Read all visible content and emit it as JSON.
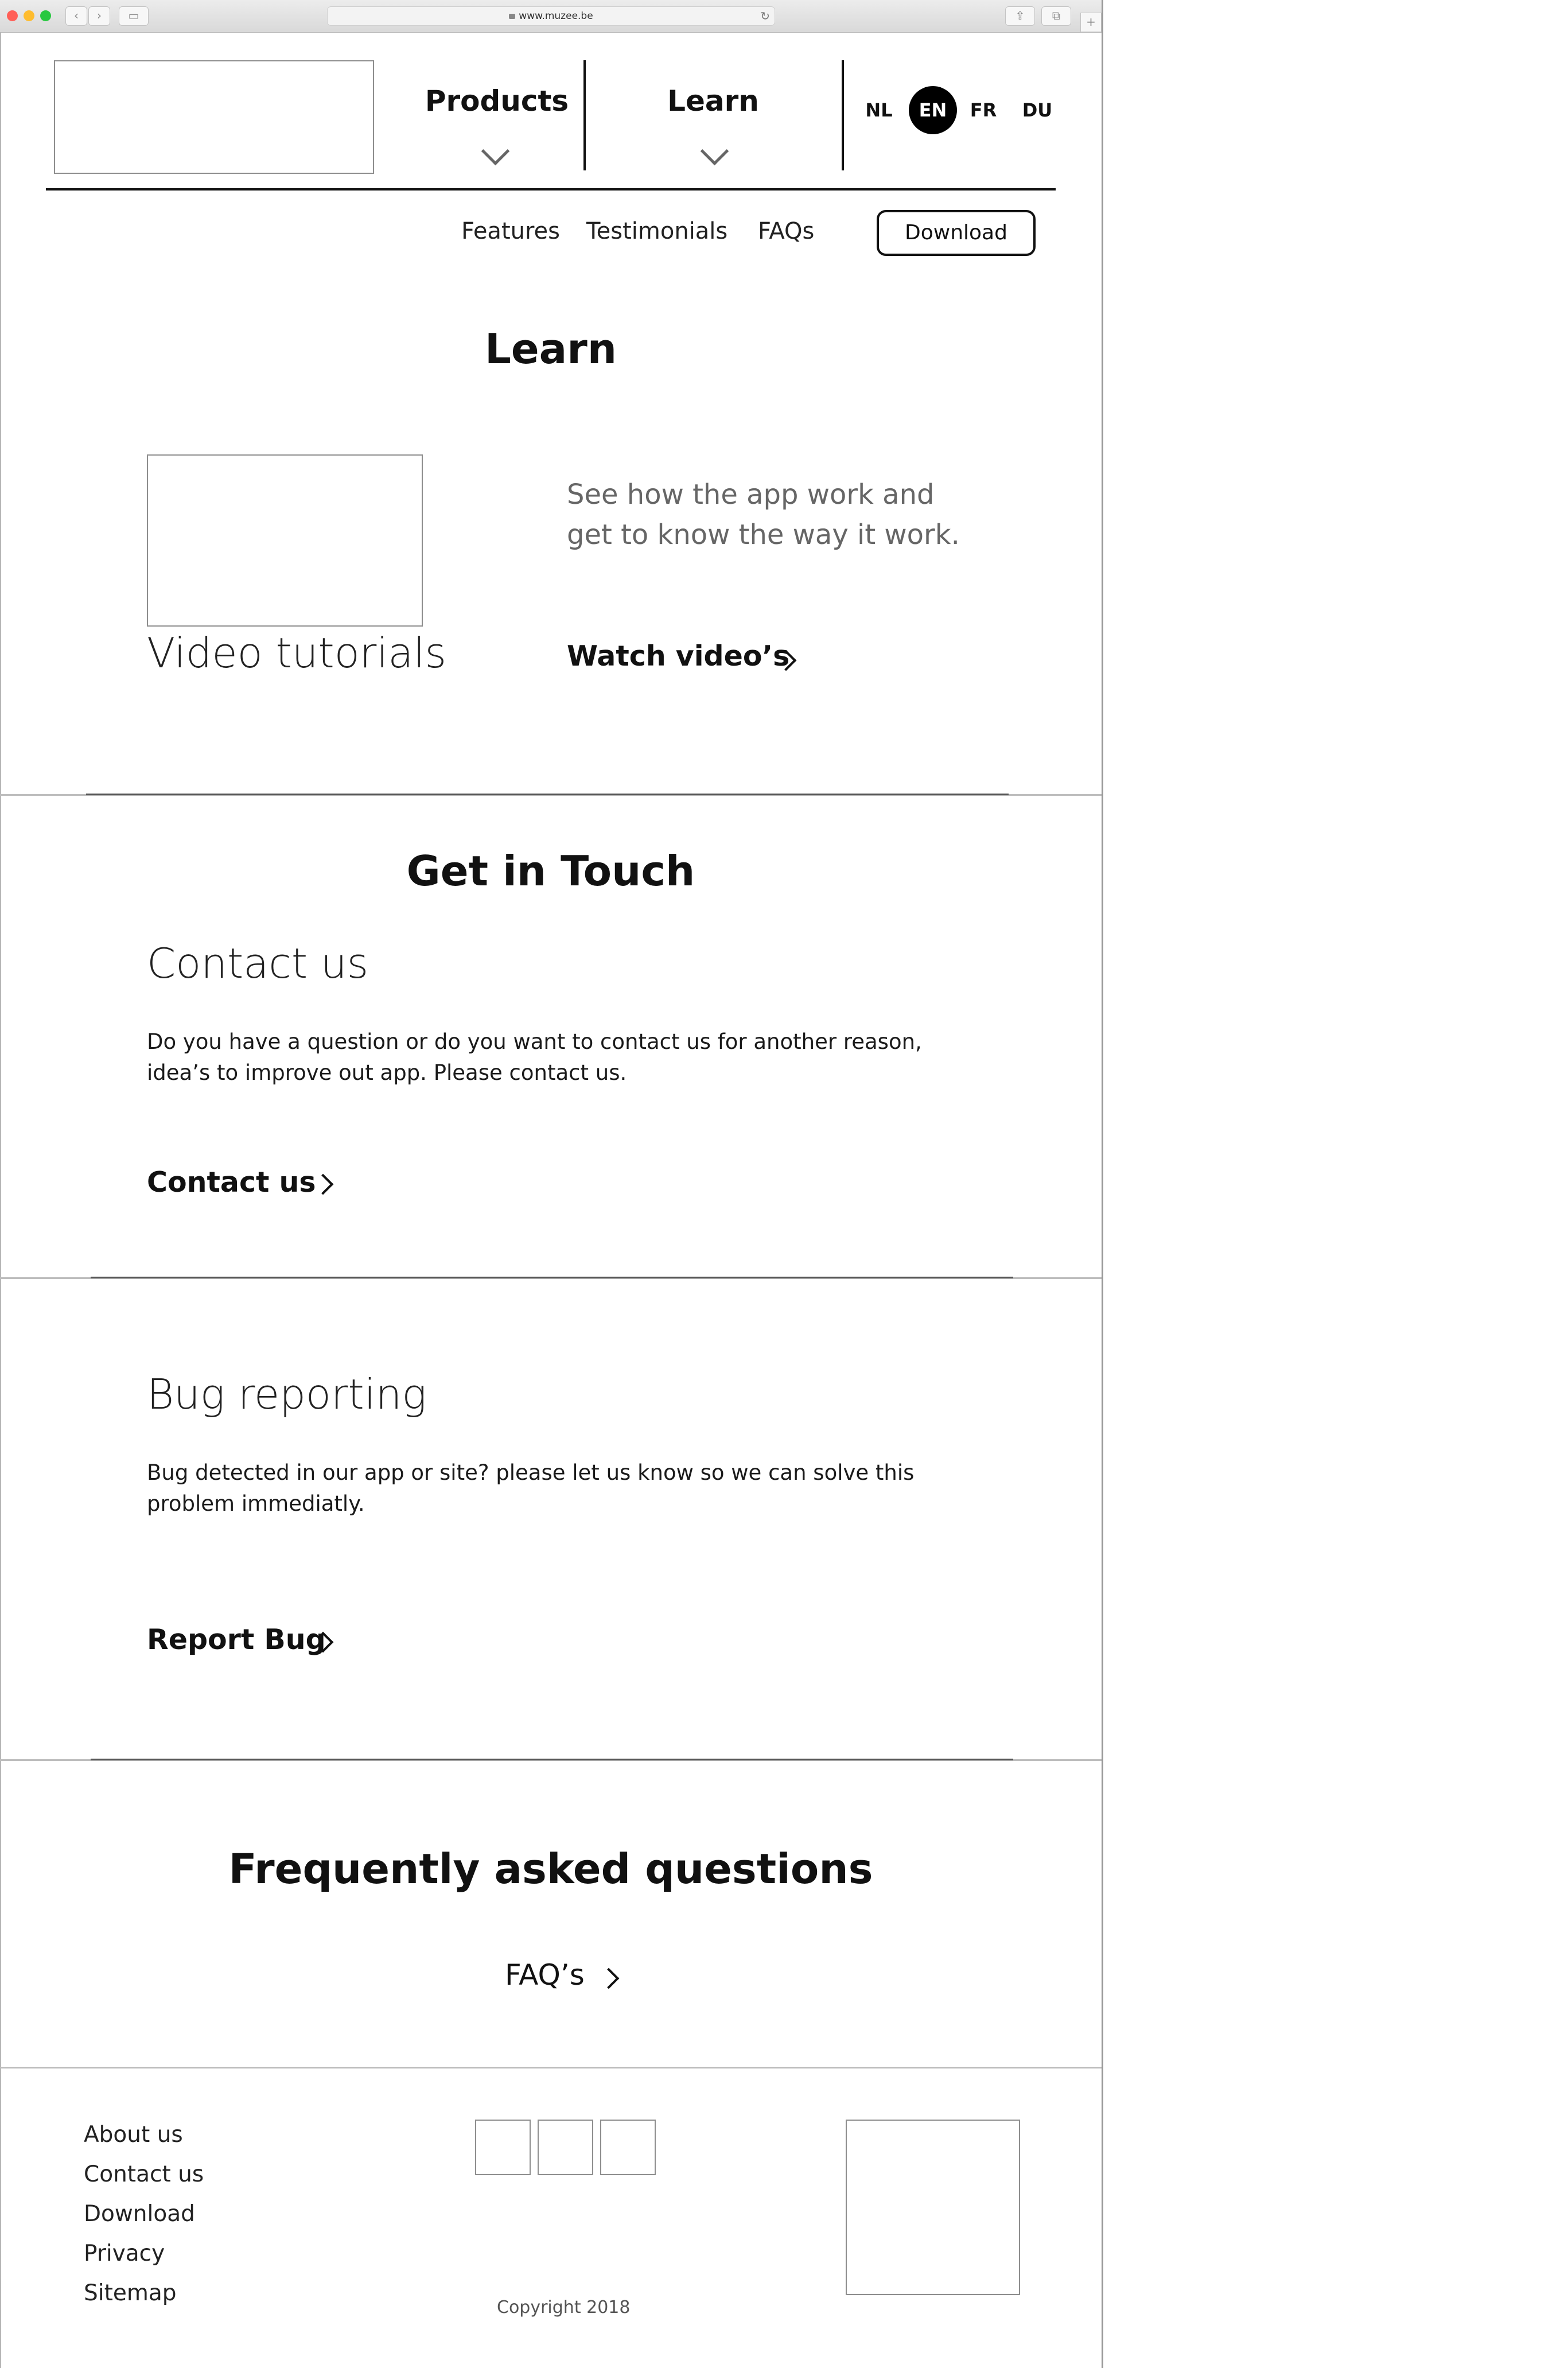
{
  "browser": {
    "url": "www.muzee.be",
    "traffic_light_colors": [
      "#ff5f57",
      "#febc2e",
      "#28c840"
    ]
  },
  "header": {
    "nav": [
      {
        "label": "Products"
      },
      {
        "label": "Learn"
      }
    ],
    "languages": [
      "NL",
      "EN",
      "FR",
      "DU"
    ],
    "active_language": "EN",
    "subnav": [
      "Features",
      "Testimonials",
      "FAQs"
    ],
    "download_label": "Download"
  },
  "learn": {
    "title": "Learn",
    "tutorial_title": "Video tutorials",
    "description": "See how the app work and get to know the way it work.",
    "cta": "Watch video’s"
  },
  "contact": {
    "title": "Get in Touch",
    "subtitle": "Contact us",
    "text_line1": "Do you have a question or do you want to contact us for another reason,",
    "text_line2": "idea’s to improve out app. Please contact us.",
    "cta": "Contact us"
  },
  "bug": {
    "subtitle": "Bug reporting",
    "text_line1": "Bug detected in our app or site? please let us know so we can solve this",
    "text_line2": "problem immediatly.",
    "cta": "Report Bug"
  },
  "faq": {
    "title": "Frequently asked questions",
    "cta": "FAQ’s"
  },
  "footer": {
    "links": [
      "About us",
      "Contact us",
      "Download",
      "Privacy",
      "Sitemap"
    ],
    "copyright": "Copyright 2018"
  }
}
